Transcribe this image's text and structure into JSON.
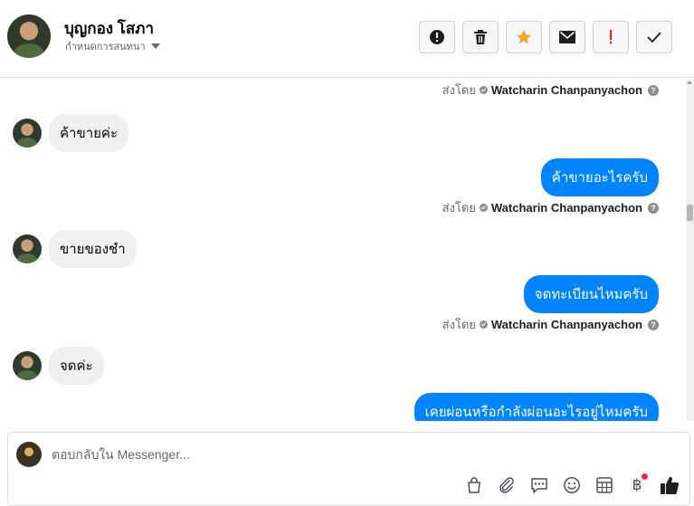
{
  "header": {
    "contact_name": "บุญกอง โสภา",
    "conversation_menu": "กำหนดการสนทนา",
    "actions": [
      "mark-spam",
      "delete",
      "star",
      "mark-unread",
      "flag-important",
      "mark-done"
    ]
  },
  "messages": {
    "sent_by_label": "ส่งโดย",
    "sender_name": "Watcharin Chanpanyachon",
    "help_glyph": "?",
    "items": [
      {
        "direction": "incoming",
        "text": "ค้าขายค่ะ"
      },
      {
        "direction": "outgoing",
        "text": "ค้าขายอะไรครับ"
      },
      {
        "direction": "incoming",
        "text": "ขายของชำ"
      },
      {
        "direction": "outgoing",
        "text": "จดทะเบียนไหมครับ"
      },
      {
        "direction": "incoming",
        "text": "จดค่ะ"
      },
      {
        "direction": "outgoing",
        "text": "เคยผ่อนหรือกำลังผ่อนอะไรอยู่ไหมครับ"
      }
    ]
  },
  "composer": {
    "placeholder": "ตอบกลับใน Messenger...",
    "value": "",
    "baht_glyph": "฿",
    "tools": [
      "shop-icon",
      "attachment-icon",
      "saved-reply-icon",
      "emoji-icon",
      "appointment-icon",
      "payment-icon",
      "like-icon"
    ]
  },
  "colors": {
    "outgoing_bubble": "#0084ff",
    "incoming_bubble": "#f0f0f0",
    "star": "#f5a623",
    "flag": "#e02424",
    "notification_dot": "#f02849"
  }
}
